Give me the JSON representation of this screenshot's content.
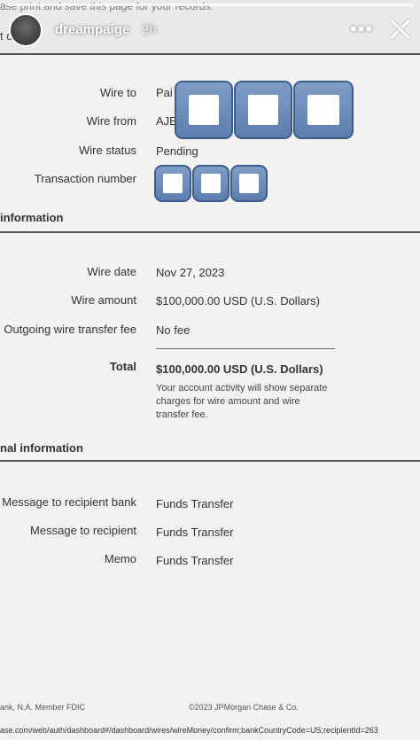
{
  "story": {
    "username": "dreampaige",
    "time": "2h",
    "top_text": "ase print and save this page for your records.",
    "left_fragment": "t d",
    "more_label": "•••"
  },
  "wire": {
    "to_label": "Wire to",
    "to_value": "Pai",
    "from_label": "Wire from",
    "from_value": "AJE",
    "status_label": "Wire status",
    "status_value": "Pending",
    "txn_label": "Transaction number"
  },
  "section_info": "information",
  "details": {
    "date_label": "Wire date",
    "date_value": "Nov 27, 2023",
    "amount_label": "Wire amount",
    "amount_value": "$100,000.00 USD (U.S. Dollars)",
    "fee_label": "Outgoing wire transfer fee",
    "fee_value": "No fee",
    "total_label": "Total",
    "total_value": "$100,000.00  USD (U.S. Dollars)",
    "note": "Your account activity will show separate charges for wire amount and wire transfer fee."
  },
  "section_additional": "nal information",
  "additional": {
    "msg_bank_label": "Message to recipient bank",
    "msg_bank_value": "Funds Transfer",
    "msg_recipient_label": "Message to recipient",
    "msg_recipient_value": "Funds Transfer",
    "memo_label": "Memo",
    "memo_value": "Funds Transfer"
  },
  "footer": {
    "left": "ank, N.A. Member FDIC",
    "right": "©2023 JPMorgan Chase & Co.",
    "url": "ase.com/web/auth/dashboard#/dashboard/wires/wireMoney/confirm;bankCountryCode=US;recipientId=263"
  }
}
